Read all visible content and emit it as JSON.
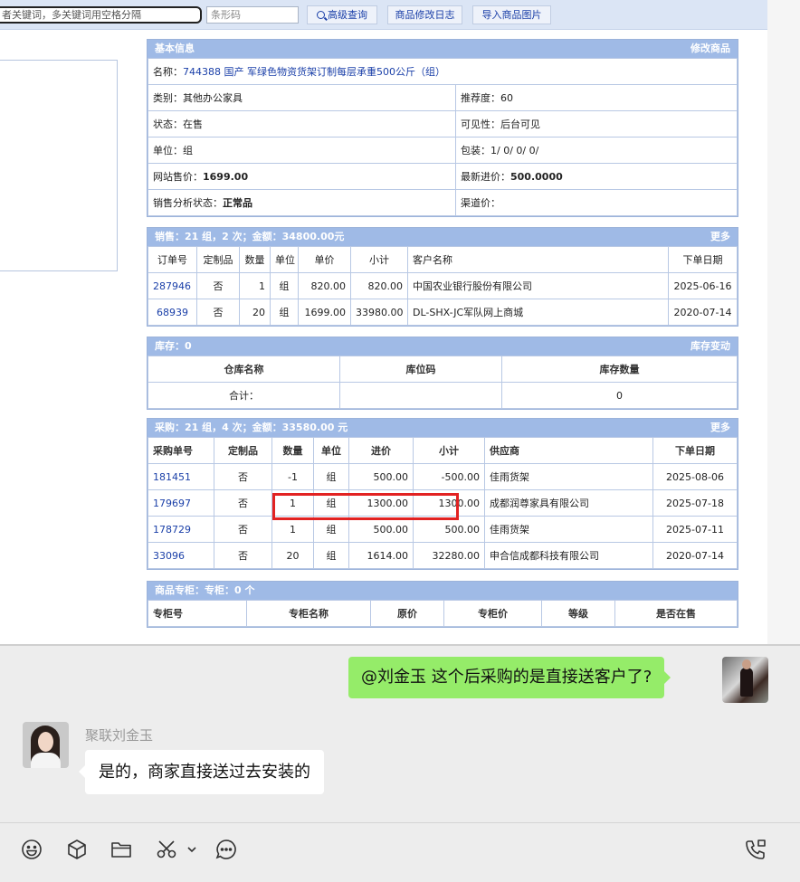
{
  "topbar": {
    "keyword_placeholder": "者关键词，多关键词用空格分隔",
    "barcode_placeholder": "条形码",
    "advanced_search": "高级查询",
    "edit_log": "商品修改日志",
    "import_images": "导入商品图片"
  },
  "basic_info": {
    "title": "基本信息",
    "edit_link": "修改商品",
    "name_label": "名称：",
    "name_value": "744388 国产 军绿色物资货架订制每层承重500公斤（组）",
    "category": "类别：其他办公家具",
    "recommend": "推荐度：60",
    "status": "状态：在售",
    "visibility": "可见性：后台可见",
    "unit": "单位：组",
    "packing": "包装：1/ 0/ 0/ 0/",
    "site_price_label": "网站售价：",
    "site_price_value": "1699.00",
    "latest_cost_label": "最新进价：",
    "latest_cost_value": "500.0000",
    "sales_status_label": "销售分析状态：",
    "sales_status_value": "正常品",
    "channel_price": "渠道价："
  },
  "sales": {
    "title": "销售：21 组，2 次；金额：34800.00元",
    "more": "更多",
    "columns": [
      "订单号",
      "定制品",
      "数量",
      "单位",
      "单价",
      "小计",
      "客户名称",
      "下单日期"
    ],
    "rows": [
      [
        "287946",
        "否",
        "1",
        "组",
        "820.00",
        "820.00",
        "中国农业银行股份有限公司",
        "2025-06-16"
      ],
      [
        "68939",
        "否",
        "20",
        "组",
        "1699.00",
        "33980.00",
        "DL-SHX-JC军队网上商城",
        "2020-07-14"
      ]
    ]
  },
  "stock": {
    "title": "库存：0",
    "change_link": "库存变动",
    "columns": [
      "仓库名称",
      "库位码",
      "库存数量"
    ],
    "total_label": "合计：",
    "total_value": "0"
  },
  "purchase": {
    "title": "采购：21 组，4 次；金额：33580.00 元",
    "more": "更多",
    "columns": [
      "采购单号",
      "定制品",
      "数量",
      "单位",
      "进价",
      "小计",
      "供应商",
      "下单日期"
    ],
    "rows": [
      [
        "181451",
        "否",
        "-1",
        "组",
        "500.00",
        "-500.00",
        "佳雨货架",
        "2025-08-06"
      ],
      [
        "179697",
        "否",
        "1",
        "组",
        "1300.00",
        "1300.00",
        "成都润尊家具有限公司",
        "2025-07-18"
      ],
      [
        "178729",
        "否",
        "1",
        "组",
        "500.00",
        "500.00",
        "佳雨货架",
        "2025-07-11"
      ],
      [
        "33096",
        "否",
        "20",
        "组",
        "1614.00",
        "32280.00",
        "申合信成都科技有限公司",
        "2020-07-14"
      ]
    ]
  },
  "counter": {
    "title": "商品专柜：专柜：0 个",
    "columns": [
      "专柜号",
      "专柜名称",
      "原价",
      "专柜价",
      "等级",
      "是否在售"
    ]
  },
  "chat": {
    "outgoing_message": "@刘金玉 这个后采购的是直接送客户了?",
    "sender_name": "聚联刘金玉",
    "incoming_message": "是的，商家直接送过去安装的"
  },
  "colors": {
    "header_blue": "#9fbae6",
    "link_blue": "#1a3fa8",
    "outgoing_bubble": "#95ec69",
    "highlight_red": "#e22222"
  },
  "toolbar_icons": [
    "emoji-icon",
    "package-icon",
    "folder-icon",
    "scissors-icon",
    "chevron-down-icon",
    "chat-history-icon",
    "phone-icon"
  ]
}
